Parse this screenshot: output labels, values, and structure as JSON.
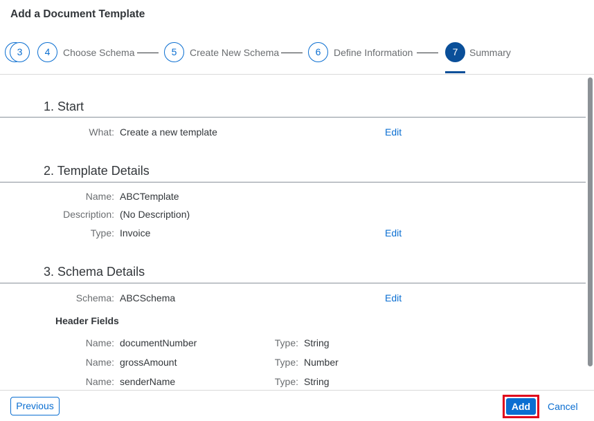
{
  "dialog": {
    "title": "Add a Document Template"
  },
  "wizard": {
    "steps": [
      {
        "number": "3"
      },
      {
        "number": "4",
        "label": "Choose Schema"
      },
      {
        "number": "5",
        "label": "Create New Schema"
      },
      {
        "number": "6",
        "label": "Define Information"
      },
      {
        "number": "7",
        "label": "Summary",
        "current": true
      }
    ]
  },
  "summary": {
    "start": {
      "title": "1. Start",
      "what_label": "What:",
      "what_value": "Create a new template",
      "edit": "Edit"
    },
    "template": {
      "title": "2. Template Details",
      "name_label": "Name:",
      "name_value": "ABCTemplate",
      "description_label": "Description:",
      "description_value": "(No Description)",
      "type_label": "Type:",
      "type_value": "Invoice",
      "edit": "Edit"
    },
    "schema": {
      "title": "3. Schema Details",
      "schema_label": "Schema:",
      "schema_value": "ABCSchema",
      "edit": "Edit",
      "header_fields_title": "Header Fields",
      "fields": [
        {
          "name_label": "Name:",
          "name": "documentNumber",
          "type_label": "Type:",
          "type": "String"
        },
        {
          "name_label": "Name:",
          "name": "grossAmount",
          "type_label": "Type:",
          "type": "Number"
        },
        {
          "name_label": "Name:",
          "name": "senderName",
          "type_label": "Type:",
          "type": "String"
        }
      ]
    }
  },
  "footer": {
    "previous": "Previous",
    "add": "Add",
    "cancel": "Cancel"
  },
  "colors": {
    "accent": "#0a6ed1",
    "current_step": "#0a4f99",
    "highlight": "#e0001b"
  }
}
